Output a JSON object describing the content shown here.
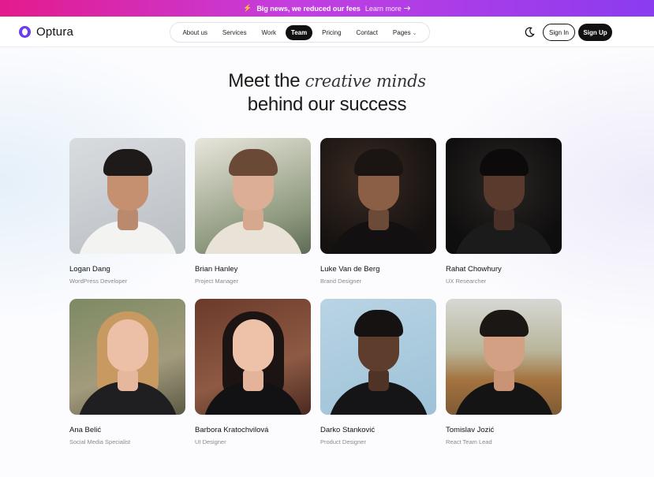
{
  "announcement": {
    "icon": "lightning-bolt-icon",
    "message": "Big news, we reduced our fees",
    "link": "Learn more",
    "link_icon": "arrow-right-icon"
  },
  "brand": {
    "name": "Optura",
    "color": "#6d3cf0"
  },
  "nav": {
    "items": [
      {
        "label": "About us",
        "active": false
      },
      {
        "label": "Services",
        "active": false
      },
      {
        "label": "Work",
        "active": false
      },
      {
        "label": "Team",
        "active": true
      },
      {
        "label": "Pricing",
        "active": false
      },
      {
        "label": "Contact",
        "active": false
      },
      {
        "label": "Pages",
        "active": false,
        "dropdown": true
      }
    ]
  },
  "actions": {
    "theme_icon": "moon-icon",
    "sign_in": "Sign In",
    "sign_up": "Sign Up"
  },
  "hero": {
    "line1_plain": "Meet the",
    "line1_italic": "creative minds",
    "line2": "behind our success"
  },
  "team": [
    {
      "name": "Logan Dang",
      "role": "WordPress Developer"
    },
    {
      "name": "Brian Hanley",
      "role": "Project Manager"
    },
    {
      "name": "Luke Van de Berg",
      "role": "Brand Designer"
    },
    {
      "name": "Rahat Chowhury",
      "role": "UX Researcher"
    },
    {
      "name": "Ana Belić",
      "role": "Social Media Specialist"
    },
    {
      "name": "Barbora Kratochvilová",
      "role": "UI Designer"
    },
    {
      "name": "Darko Stanković",
      "role": "Product Designer"
    },
    {
      "name": "Tomislav Jozić",
      "role": "React Team Lead"
    }
  ]
}
